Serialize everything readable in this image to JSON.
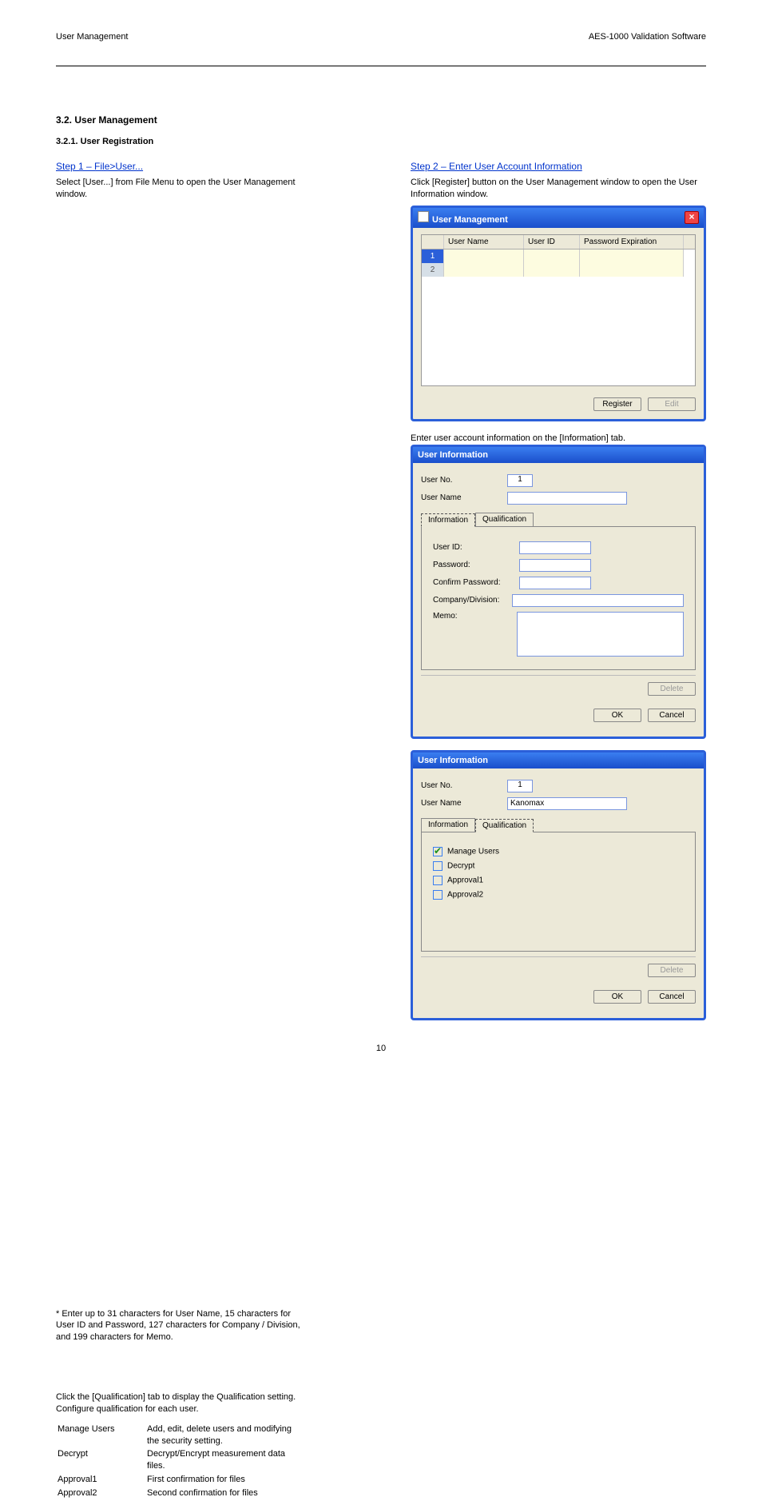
{
  "header": {
    "left": "User Management",
    "right": "AES-1000 Validation Software"
  },
  "page_number": "10",
  "section": {
    "title": "3.2. User Management",
    "subtitle_primary": "3.2.1. User Registration",
    "step1_head": "Step 1 – File>User...",
    "step1_body": "Select [User...] from File Menu to open the User Management window.",
    "step2_head": "Step 2 – Enter User Account Information",
    "step2_body1": "Click [Register] button on the User Management window to open the User Information window.",
    "step2_body2": "Enter user account information on the [Information] tab.",
    "form_hint": "*  Enter up to 31 characters for User Name, 15 characters for User ID and Password, 127 characters for Company / Division, and 199 characters for Memo.",
    "qualif_intro": "Click the [Qualification] tab to display the Qualification setting.\nConfigure qualification for each user.",
    "qualif_table": [
      {
        "name": "Manage Users",
        "desc": "Add, edit, delete users and modifying the security setting."
      },
      {
        "name": "Decrypt",
        "desc": "Decrypt/Encrypt measurement data files."
      },
      {
        "name": "Approval1",
        "desc": "First confirmation for files"
      },
      {
        "name": "Approval2",
        "desc": "Second confirmation for files"
      }
    ]
  },
  "dlg_user_mgmt": {
    "title": "User Management",
    "cols": [
      "",
      "User Name",
      "User ID",
      "Password Expiration"
    ],
    "rows": [
      [
        "1",
        "",
        "",
        ""
      ],
      [
        "2",
        "",
        "",
        ""
      ]
    ],
    "btn_register": "Register",
    "btn_edit": "Edit"
  },
  "dlg_user_info1": {
    "title": "User Information",
    "user_no_label": "User No.",
    "user_no_value": "1",
    "user_name_label": "User Name",
    "user_name_value": "",
    "tab_info": "Information",
    "tab_qual": "Qualification",
    "fields": {
      "user_id": "User ID:",
      "password": "Password:",
      "confirm": "Confirm Password:",
      "company": "Company/Division:",
      "memo": "Memo:"
    },
    "btn_delete": "Delete",
    "btn_ok": "OK",
    "btn_cancel": "Cancel"
  },
  "dlg_user_info2": {
    "title": "User Information",
    "user_no_label": "User No.",
    "user_no_value": "1",
    "user_name_label": "User Name",
    "user_name_value": "Kanomax",
    "tab_info": "Information",
    "tab_qual": "Qualification",
    "checks": [
      {
        "label": "Manage Users",
        "checked": true
      },
      {
        "label": "Decrypt",
        "checked": false
      },
      {
        "label": "Approval1",
        "checked": false
      },
      {
        "label": "Approval2",
        "checked": false
      }
    ],
    "btn_delete": "Delete",
    "btn_ok": "OK",
    "btn_cancel": "Cancel"
  }
}
